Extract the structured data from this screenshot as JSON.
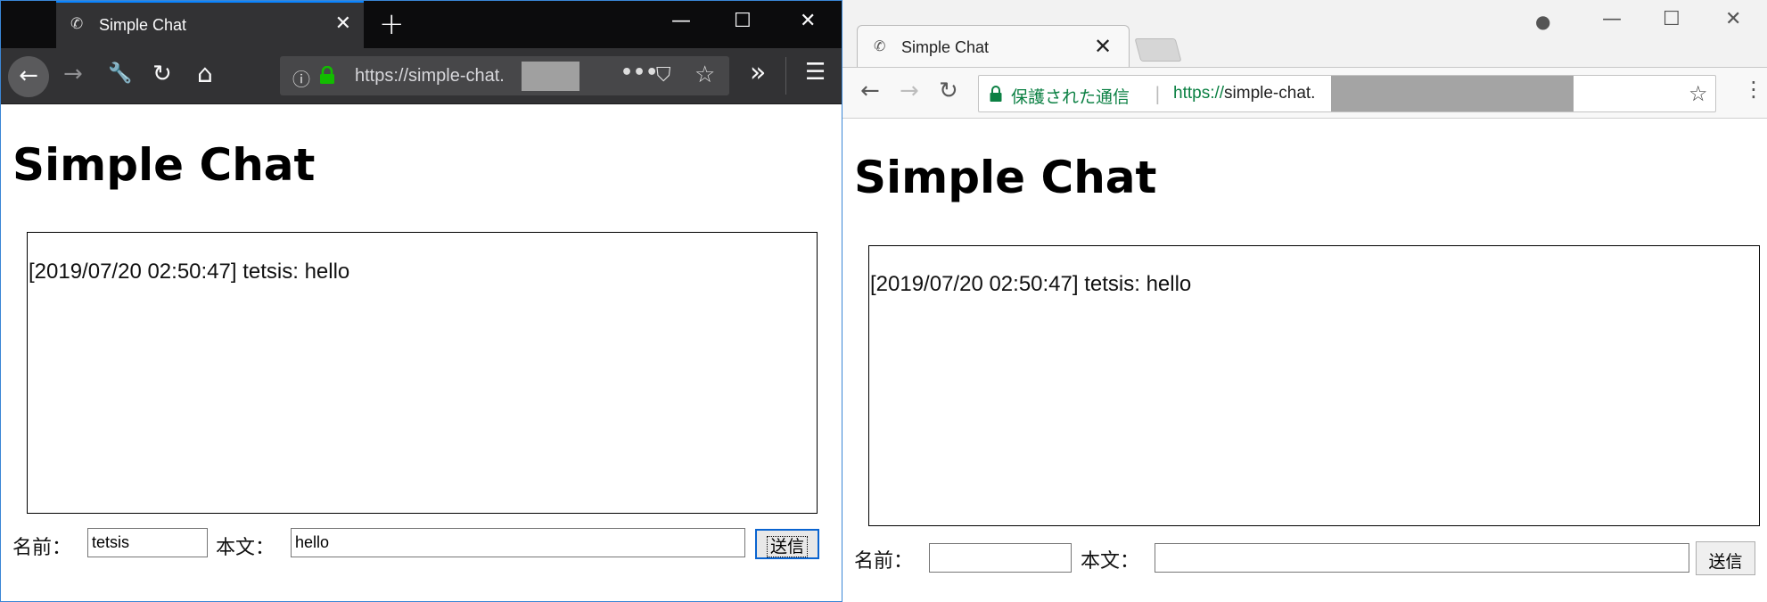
{
  "firefox": {
    "tab": {
      "title": "Simple Chat",
      "favicon": "chat-favicon-icon",
      "close": "✕"
    },
    "new_tab": "+",
    "window_controls": {
      "minimize": "—",
      "maximize": "☐",
      "close": "✕"
    },
    "nav": {
      "back": "←",
      "forward": "→",
      "tools": "🔧",
      "reload": "↻",
      "home": "⌂"
    },
    "url": {
      "info": "ⓘ",
      "text": "https://simple-chat.",
      "more": "•••",
      "pocket": "⛉",
      "star": "☆"
    },
    "overflow": "»",
    "menu": "☰",
    "page": {
      "heading": "Simple Chat",
      "log_entries": [
        "[2019/07/20 02:50:47] tetsis: hello"
      ],
      "name_label": "名前：",
      "name_value": "tetsis",
      "body_label": "本文：",
      "body_value": "hello",
      "send_label": "送信"
    }
  },
  "chrome": {
    "tab": {
      "title": "Simple Chat",
      "favicon": "chat-favicon-icon",
      "close": "✕"
    },
    "account_icon": "●",
    "window_controls": {
      "minimize": "—",
      "maximize": "☐",
      "close": "✕"
    },
    "nav": {
      "back": "←",
      "forward": "→",
      "reload": "↻"
    },
    "url": {
      "secure_label": "保護された通信",
      "separator": "|",
      "protocol": "https://",
      "host": "simple-chat.",
      "star": "☆"
    },
    "menu": "⋮",
    "page": {
      "heading": "Simple Chat",
      "log_entries": [
        "[2019/07/20 02:50:47] tetsis: hello"
      ],
      "name_label": "名前：",
      "name_value": "",
      "body_label": "本文：",
      "body_value": "",
      "send_label": "送信"
    }
  },
  "colors": {
    "firefox_dark": "#323234",
    "firefox_accent": "#0a84ff",
    "secure_green": "#0b8043",
    "ff_lock_green": "#12bc00"
  }
}
